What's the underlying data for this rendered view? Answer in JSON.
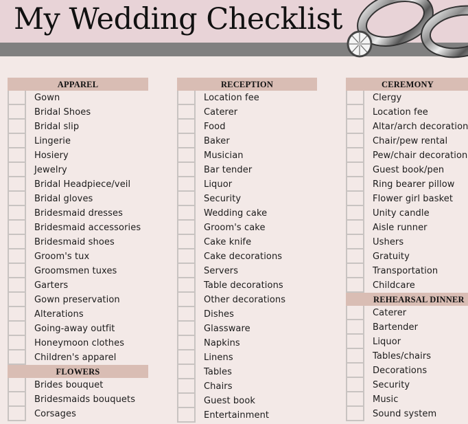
{
  "header": {
    "title": "My Wedding Checklist",
    "image": "wedding-rings-icon"
  },
  "colors": {
    "title_bg": "#e8d3d7",
    "band": "#808080",
    "page_bg": "#f3e9e7",
    "section_header_bg": "#d9bdb4"
  },
  "columns": [
    {
      "sections": [
        {
          "title": "APPAREL",
          "items": [
            "Gown",
            "Bridal Shoes",
            "Bridal slip",
            "Lingerie",
            "Hosiery",
            "Jewelry",
            "Bridal Headpiece/veil",
            "Bridal gloves",
            "Bridesmaid dresses",
            "Bridesmaid accessories",
            "Bridesmaid shoes",
            "Groom's tux",
            "Groomsmen tuxes",
            "Garters",
            "Gown preservation",
            "Alterations",
            "Going-away outfit",
            "Honeymoon clothes",
            "Children's apparel"
          ]
        },
        {
          "title": "FLOWERS",
          "items": [
            "Brides bouquet",
            "Bridesmaids bouquets",
            "Corsages"
          ]
        }
      ]
    },
    {
      "sections": [
        {
          "title": "RECEPTION",
          "items": [
            "Location fee",
            "Caterer",
            "Food",
            "Baker",
            "Musician",
            "Bar tender",
            "Liquor",
            "Security",
            "Wedding cake",
            "Groom's cake",
            "Cake knife",
            "Cake decorations",
            "Servers",
            "Table decorations",
            "Other decorations",
            "Dishes",
            "Glassware",
            "Napkins",
            "Linens",
            "Tables",
            "Chairs",
            "Guest book",
            "Entertainment"
          ]
        }
      ]
    },
    {
      "sections": [
        {
          "title": "CEREMONY",
          "items": [
            "Clergy",
            "Location fee",
            "Altar/arch decoration",
            "Chair/pew rental",
            "Pew/chair decoration",
            "Guest book/pen",
            "Ring bearer pillow",
            "Flower girl basket",
            "Unity candle",
            "Aisle runner",
            "Ushers",
            "Gratuity",
            "Transportation",
            "Childcare"
          ]
        },
        {
          "title": "REHEARSAL DINNER",
          "items": [
            "Caterer",
            "Bartender",
            "Liquor",
            "Tables/chairs",
            "Decorations",
            "Security",
            "Music",
            "Sound system"
          ]
        }
      ]
    }
  ]
}
